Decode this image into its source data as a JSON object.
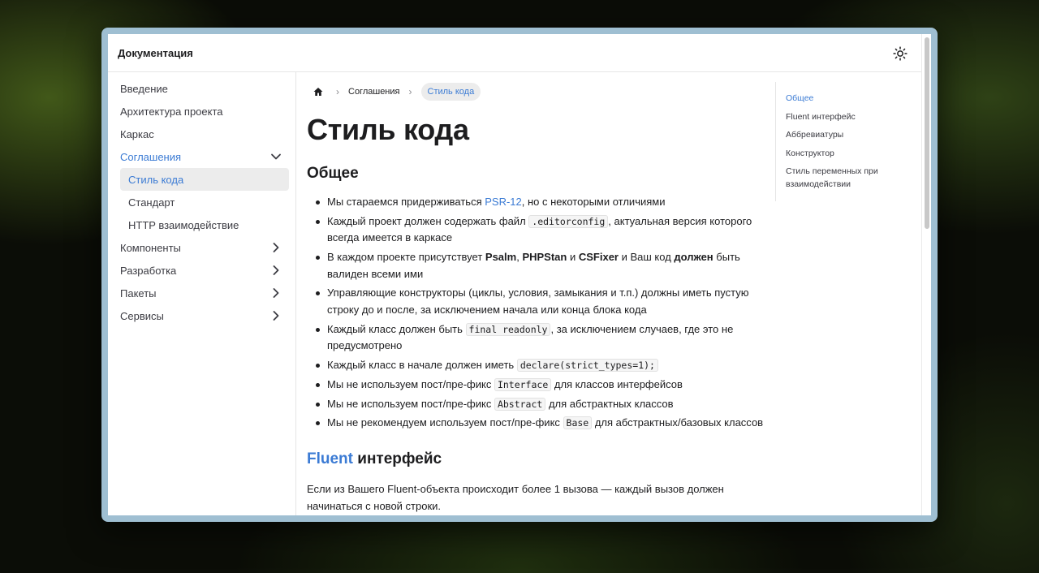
{
  "header": {
    "title": "Документация"
  },
  "sidebar": {
    "items": [
      {
        "label": "Введение"
      },
      {
        "label": "Архитектура проекта"
      },
      {
        "label": "Каркас"
      },
      {
        "label": "Соглашения"
      },
      {
        "label": "Стиль кода"
      },
      {
        "label": "Стандарт"
      },
      {
        "label": "HTTP взаимодействие"
      },
      {
        "label": "Компоненты"
      },
      {
        "label": "Разработка"
      },
      {
        "label": "Пакеты"
      },
      {
        "label": "Сервисы"
      }
    ]
  },
  "breadcrumb": {
    "section": "Соглашения",
    "current": "Стиль кода"
  },
  "page": {
    "title": "Стиль кода",
    "general": {
      "heading": "Общее",
      "rules": [
        {
          "t1": "Мы стараемся придерживаться ",
          "link": "PSR-12",
          "t2": ", но с некоторыми отличиями"
        },
        {
          "t1": "Каждый проект должен содержать файл ",
          "code": ".editorconfig",
          "t2": ", актуальная версия которого всегда имеется в каркасе"
        },
        {
          "t1": "В каждом проекте присутствует ",
          "b1": "Psalm",
          "s1": ", ",
          "b2": "PHPStan",
          "s2": " и ",
          "b3": "CSFixer",
          "s3": " и Ваш код ",
          "b4": "должен",
          "t2": " быть валиден всеми ими"
        },
        {
          "t1": "Управляющие конструкторы (циклы, условия, замыкания и т.п.) должны иметь пустую строку до и после, за исключением начала или конца блока кода"
        },
        {
          "t1": "Каждый класс должен быть ",
          "code": "final readonly",
          "t2": ", за исключением случаев, где это не предусмотрено"
        },
        {
          "t1": "Каждый класс в начале должен иметь ",
          "code": "declare(strict_types=1);"
        },
        {
          "t1": "Мы не используем пост/пре-фикс ",
          "code": "Interface",
          "t2": " для классов интерфейсов"
        },
        {
          "t1": "Мы не используем пост/пре-фикс ",
          "code": "Abstract",
          "t2": " для абстрактных классов"
        },
        {
          "t1": "Мы не рекомендуем используем пост/пре-фикс ",
          "code": "Base",
          "t2": " для абстрактных/базовых классов"
        }
      ]
    },
    "fluent": {
      "heading_link": "Fluent",
      "heading_rest": " интерфейс",
      "paragraph": "Если из Вашего Fluent-объекта происходит более 1 вызова — каждый вызов должен начинаться с новой строки."
    }
  },
  "toc": {
    "items": [
      {
        "label": "Общее"
      },
      {
        "label": "Fluent интерфейс"
      },
      {
        "label": "Аббревиатуры"
      },
      {
        "label": "Конструктор"
      },
      {
        "label": "Стиль переменных при взаимодействии"
      }
    ]
  },
  "colors": {
    "accent": "#3b7bd4",
    "text": "#1d1d1f",
    "muted": "#3c3c43",
    "frame": "#9fbfd2"
  },
  "icons": {
    "theme": "sun-icon",
    "home": "home-icon",
    "expand": "chevron-down-icon",
    "collapse": "chevron-right-icon"
  }
}
